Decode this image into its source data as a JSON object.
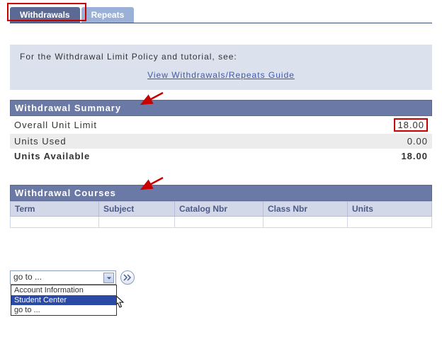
{
  "tabs": {
    "active": "Withdrawals",
    "inactive": "Repeats"
  },
  "info": {
    "text": "For the Withdrawal Limit Policy and tutorial, see:",
    "link": "View Withdrawals/Repeats Guide"
  },
  "summary": {
    "header": "Withdrawal Summary",
    "rows": {
      "limit_label": "Overall Unit Limit",
      "limit_value": "18.00",
      "used_label": "Units Used",
      "used_value": "0.00",
      "avail_label": "Units Available",
      "avail_value": "18.00"
    }
  },
  "courses": {
    "header": "Withdrawal Courses",
    "columns": {
      "term": "Term",
      "subject": "Subject",
      "catalog": "Catalog Nbr",
      "classnbr": "Class Nbr",
      "units": "Units"
    }
  },
  "nav": {
    "selected": "go to ...",
    "options": {
      "opt1": "Account Information",
      "opt2": "Student Center",
      "opt3": "go to ..."
    }
  }
}
